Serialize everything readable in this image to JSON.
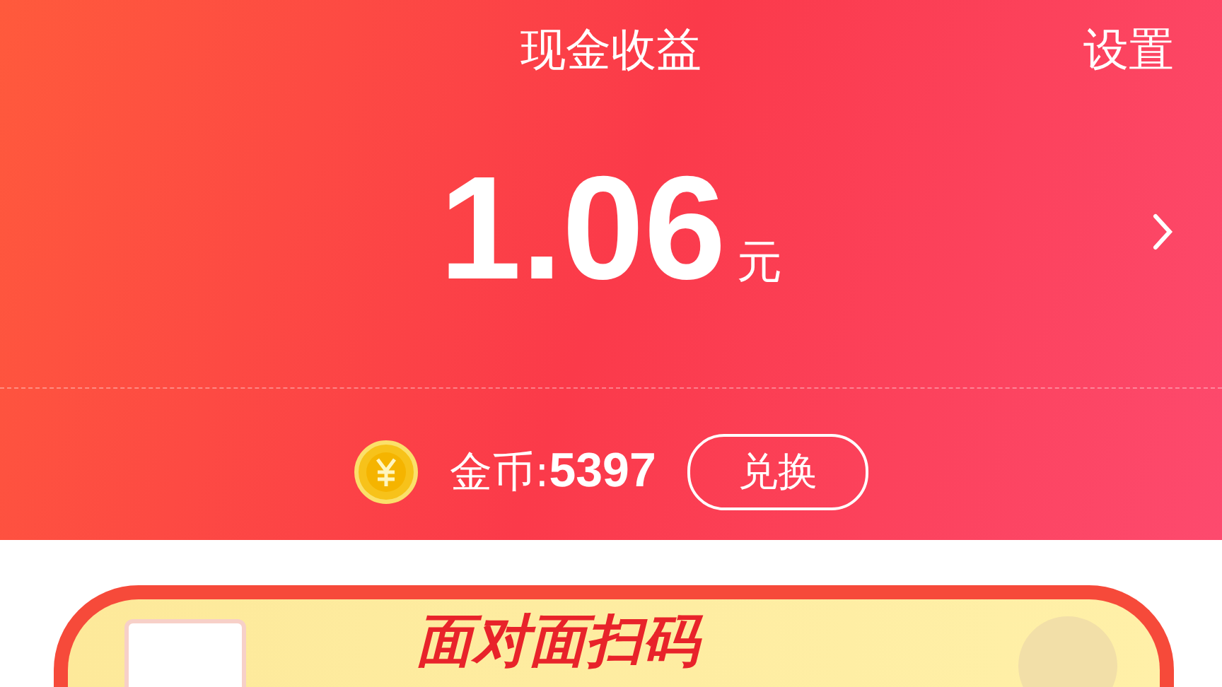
{
  "header": {
    "title": "现金收益",
    "settings": "设置"
  },
  "balance": {
    "amount": "1.06",
    "unit": "元"
  },
  "coins": {
    "label": "金币:**5397**",
    "exchange": "兑换"
  },
  "banner": {
    "title": "面对面扫码"
  }
}
